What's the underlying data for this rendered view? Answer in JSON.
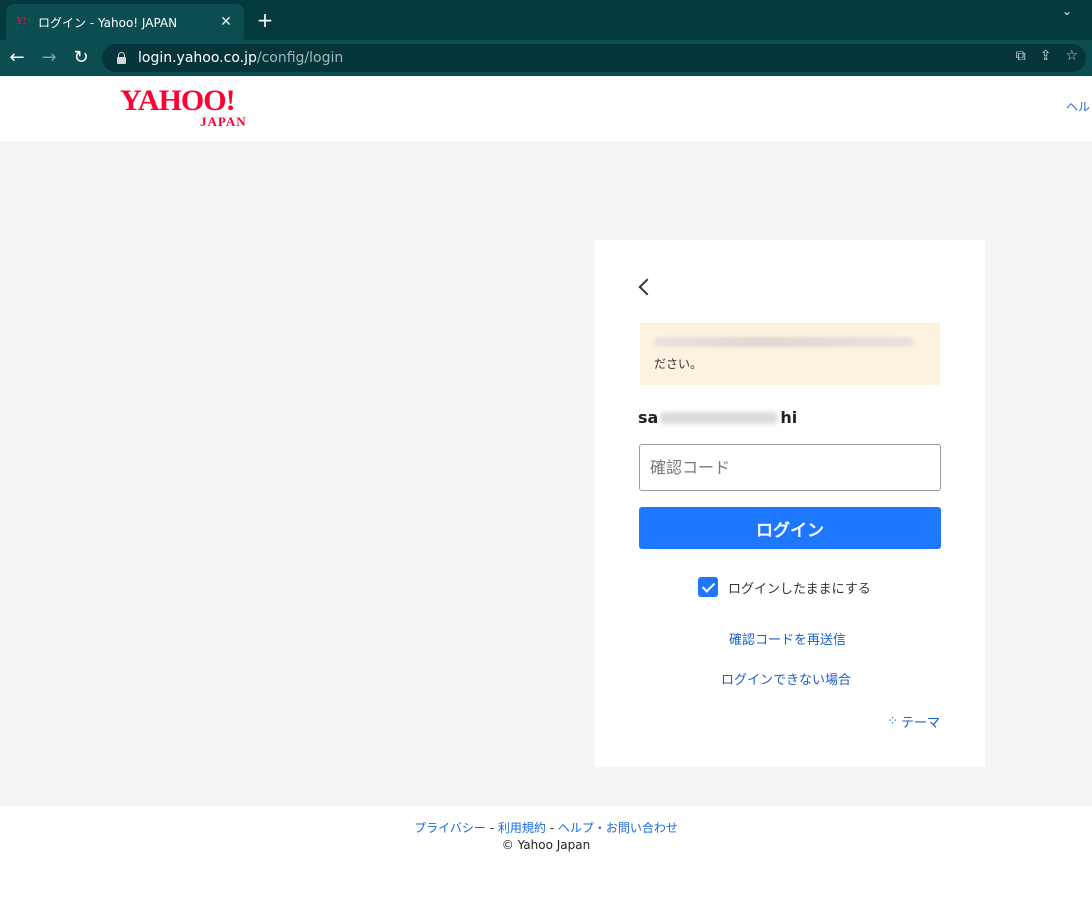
{
  "browser": {
    "tab_title": "ログイン - Yahoo! JAPAN",
    "favicon_text": "Y!",
    "new_tab_label": "+",
    "close_glyph": "✕",
    "url_host": "login.yahoo.co.jp",
    "url_path": "/config/login"
  },
  "header": {
    "logo_text": "YAHOO!",
    "logo_sub": "JAPAN",
    "help_link": "ヘル"
  },
  "card": {
    "notice_text": "ださい。",
    "username_prefix": "sa",
    "username_suffix": "hi",
    "code_placeholder": "確認コード",
    "login_button": "ログイン",
    "keep_logged_in": "ログインしたままにする",
    "keep_logged_in_checked": true,
    "resend_link": "確認コードを再送信",
    "trouble_link": "ログインできない場合",
    "theme_link": "テーマ"
  },
  "footer": {
    "privacy": "プライバシー",
    "terms": "利用規約",
    "help": "ヘルプ・お問い合わせ",
    "separator": " - ",
    "copyright": "© Yahoo Japan"
  },
  "colors": {
    "accent": "#1e78ff",
    "brand": "#ff0033",
    "chrome": "#0c4d52",
    "notice_bg": "#fdf2e0"
  }
}
